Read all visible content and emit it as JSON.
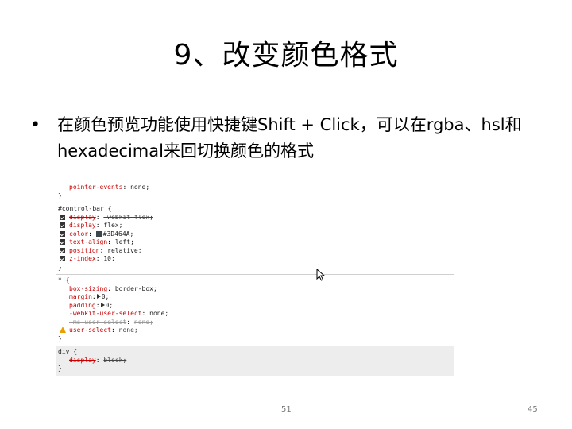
{
  "slide": {
    "title": "9、改变颜色格式",
    "bullet": "在颜色预览功能使用快捷键Shift + Click，可以在rgba、hsl和hexadecimal来回切换颜色的格式",
    "footer_center": "51",
    "footer_right": "45"
  },
  "css_panel": {
    "rules": [
      {
        "lines": [
          {
            "prop": "pointer-events",
            "val": "none;"
          },
          {
            "text": "}"
          }
        ]
      },
      {
        "selector": "#control-bar {",
        "decls": [
          {
            "prop": "display",
            "val": "-webkit-flex;",
            "struck": true,
            "checked": true
          },
          {
            "prop": "display",
            "val": "flex;",
            "checked": true
          },
          {
            "prop": "color",
            "val": "#3D464A;",
            "checked": true,
            "swatch": "#3D464A"
          },
          {
            "prop": "text-align",
            "val": "left;",
            "checked": true
          },
          {
            "prop": "position",
            "val": "relative;",
            "checked": true
          },
          {
            "prop": "z-index",
            "val": "10;",
            "checked": true
          }
        ],
        "close": "}"
      },
      {
        "selector": "* {",
        "decls": [
          {
            "prop": "box-sizing",
            "val": "border-box;"
          },
          {
            "prop": "margin",
            "val": "0;",
            "arrow": true
          },
          {
            "prop": "padding",
            "val": "0;",
            "arrow": true
          },
          {
            "prop": "-webkit-user-select",
            "val": "none;"
          },
          {
            "prop": "-ms-user-select",
            "val": "none;",
            "struck": true,
            "dim": true
          },
          {
            "prop": "user-select",
            "val": "none;",
            "struck": true,
            "warning": true
          }
        ],
        "close": "}"
      },
      {
        "selector": "div {",
        "decls": [
          {
            "prop": "display",
            "val": "block;",
            "struck": true
          }
        ],
        "close": "}"
      }
    ]
  },
  "colors": {
    "swatch": "#3D464A",
    "property": "#c80000",
    "warning": "#e8a000"
  },
  "icons": {
    "cursor": "mouse-pointer-icon",
    "checkbox": "checkbox-checked-icon",
    "warning": "warning-triangle-icon",
    "expand": "expand-triangle-icon"
  }
}
